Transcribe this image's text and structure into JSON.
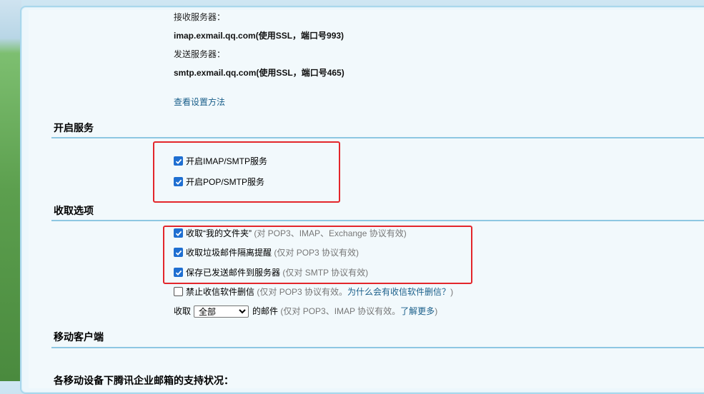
{
  "server": {
    "imap_label": "接收服务器：",
    "imap_value": "imap.exmail.qq.com(使用SSL，端口号993)",
    "smtp_label": "发送服务器：",
    "smtp_value": "smtp.exmail.qq.com(使用SSL，端口号465)",
    "setup_link": "查看设置方法"
  },
  "services": {
    "title": "开启服务",
    "imap_smtp": {
      "label": "开启IMAP/SMTP服务",
      "checked": true
    },
    "pop_smtp": {
      "label": "开启POP/SMTP服务",
      "checked": true
    }
  },
  "receive": {
    "title": "收取选项",
    "my_folders": {
      "label": "收取“我的文件夹”",
      "note": "(对 POP3、IMAP、Exchange 协议有效)",
      "checked": true
    },
    "spam_alert": {
      "label": "收取垃圾邮件隔离提醒",
      "note": "(仅对 POP3 协议有效)",
      "checked": true
    },
    "save_sent": {
      "label": "保存已发送邮件到服务器",
      "note": "(仅对 SMTP 协议有效)",
      "checked": true
    },
    "no_delete": {
      "label": "禁止收信软件删信",
      "note": "(仅对 POP3 协议有效。",
      "why_link": "为什么会有收信软件删信？",
      "note_end": ")",
      "checked": false
    },
    "fetch_prefix": "收取",
    "fetch_select": {
      "selected": "全部",
      "options": [
        "全部"
      ]
    },
    "fetch_suffix": "的邮件",
    "fetch_note": "(仅对 POP3、IMAP 协议有效。",
    "learn_more": "了解更多",
    "fetch_note_end": ")"
  },
  "mobile": {
    "title": "移动客户端",
    "partial_text": "各移动设备下腾讯企业邮箱的支持状况："
  },
  "colors": {
    "checkbox": "#1f6fd1",
    "highlight": "#e3262b",
    "divider": "#8ec7e2",
    "link": "#1a5f8a"
  }
}
